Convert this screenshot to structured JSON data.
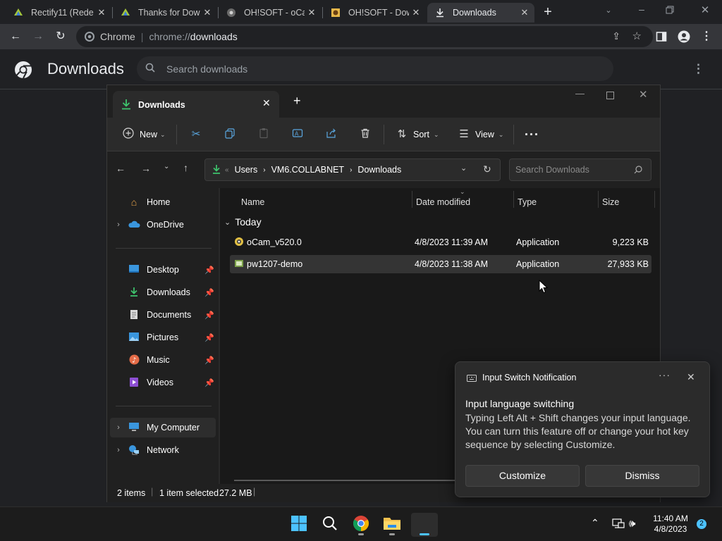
{
  "browser": {
    "tabs": [
      {
        "title": "Rectify11 (Rede",
        "icon": "rectify-icon"
      },
      {
        "title": "Thanks for Dow",
        "icon": "rectify-icon"
      },
      {
        "title": "OH!SOFT - oCa",
        "icon": "ohsoft-icon"
      },
      {
        "title": "OH!SOFT - Dow",
        "icon": "ohsoft-icon"
      },
      {
        "title": "Downloads",
        "icon": "download-icon"
      }
    ],
    "omnibox": {
      "site_label": "Chrome",
      "url_prefix": "chrome://",
      "url_path": "downloads"
    }
  },
  "downloads_page": {
    "title": "Downloads",
    "search_placeholder": "Search downloads"
  },
  "explorer": {
    "tab_title": "Downloads",
    "commands": {
      "new": "New",
      "sort": "Sort",
      "view": "View"
    },
    "breadcrumb": [
      "Users",
      "VM6.COLLABNET",
      "Downloads"
    ],
    "search_placeholder": "Search Downloads",
    "nav": {
      "home": "Home",
      "onedrive": "OneDrive",
      "desktop": "Desktop",
      "downloads": "Downloads",
      "documents": "Documents",
      "pictures": "Pictures",
      "music": "Music",
      "videos": "Videos",
      "my_computer": "My Computer",
      "network": "Network"
    },
    "columns": {
      "name": "Name",
      "date": "Date modified",
      "type": "Type",
      "size": "Size"
    },
    "group": "Today",
    "files": [
      {
        "name": "oCam_v520.0",
        "date": "4/8/2023 11:39 AM",
        "type": "Application",
        "size": "9,223 KB"
      },
      {
        "name": "pw1207-demo",
        "date": "4/8/2023 11:38 AM",
        "type": "Application",
        "size": "27,933 KB"
      }
    ],
    "status": {
      "items": "2 items",
      "selected": "1 item selected",
      "size": "27.2 MB"
    }
  },
  "notification": {
    "app": "Input Switch Notification",
    "title": "Input language switching",
    "body": "Typing Left Alt + Shift changes your input language. You can turn this feature off or change your hot key sequence by selecting Customize.",
    "customize": "Customize",
    "dismiss": "Dismiss"
  },
  "taskbar": {
    "time": "11:40 AM",
    "date": "4/8/2023",
    "badge": "2"
  },
  "colors": {
    "accent": "#4cc2ff",
    "download_green": "#3ec46d"
  }
}
